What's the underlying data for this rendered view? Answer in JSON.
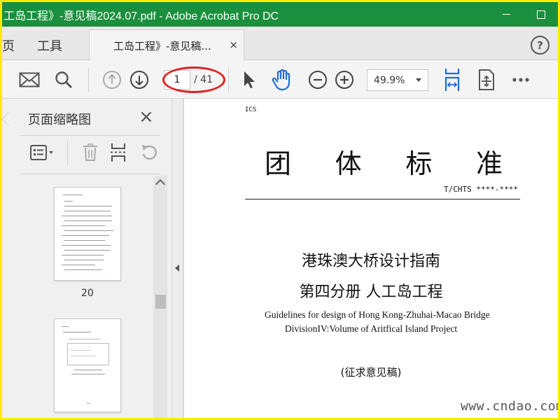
{
  "window": {
    "title": "工岛工程》-意见稿2024.07.pdf - Adobe Acrobat Pro DC"
  },
  "nav": {
    "home_label": "页",
    "tools_label": "工具"
  },
  "tab": {
    "label": "工岛工程》-意见稿...",
    "close": "×"
  },
  "help": {
    "label": "?"
  },
  "toolbar": {
    "current_page": "1",
    "total_pages": "/ 41",
    "zoom": "49.9%"
  },
  "side_panel": {
    "title": "页面缩略图",
    "close": "×",
    "thumbnails": [
      {
        "page_label": "20"
      },
      {
        "page_label": ""
      }
    ]
  },
  "document": {
    "ics": "ICS",
    "title_chars": [
      "团",
      "体",
      "标",
      "准"
    ],
    "standard_code": "T/CHTS ****-****",
    "cn_title_line1": "港珠澳大桥设计指南",
    "cn_title_line2": "第四分册  人工岛工程",
    "en_title_line1": "Guidelines for design of Hong Kong-Zhuhai-Macao Bridge",
    "en_title_line2": "DivisionIV:Volume of Aritfical Island Project",
    "draft_label": "(征求意见稿)"
  },
  "watermark": "www.cndao.com",
  "colors": {
    "title_bar": "#1a8f3d",
    "highlight_border": "#ffeb00",
    "annotation_oval": "#e02020",
    "accent_blue": "#1e6fd0"
  },
  "icons": [
    "email-icon",
    "search-icon",
    "prev-page-icon",
    "next-page-icon",
    "select-cursor-icon",
    "hand-tool-icon",
    "zoom-out-icon",
    "zoom-in-icon",
    "scroll-mode-icon",
    "fit-page-icon",
    "more-icon",
    "options-list-icon",
    "delete-icon",
    "insert-pages-icon",
    "rotate-icon"
  ]
}
